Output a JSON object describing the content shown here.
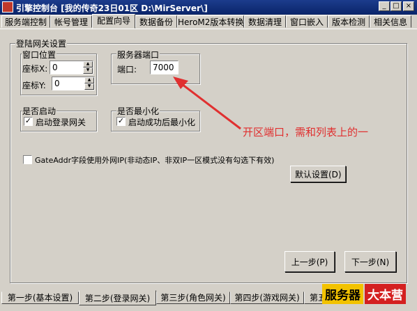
{
  "window": {
    "title": "引擎控制台 [我的传奇23日01区 D:\\MirServer\\]",
    "min_glyph": "_",
    "max_glyph": "□",
    "close_glyph": "×"
  },
  "tabs": [
    "服务端控制",
    "帐号管理",
    "配置向导",
    "数据备份",
    "HeroM2版本转换",
    "数据清理",
    "窗口嵌入",
    "版本检测",
    "相关信息"
  ],
  "active_tab": "配置向导",
  "gateway_group": {
    "title": "登陆网关设置",
    "window_pos": {
      "title": "窗口位置",
      "x_label": "座标X:",
      "x_value": "0",
      "y_label": "座标Y:",
      "y_value": "0"
    },
    "server_port": {
      "title": "服务器端口",
      "port_label": "端口:",
      "port_value": "7000"
    },
    "autostart": {
      "title": "是否启动",
      "checkbox_label": "启动登录网关",
      "checked": true
    },
    "minimize": {
      "title": "是否最小化",
      "checkbox_label": "启动成功后最小化",
      "checked": true
    },
    "gateaddr_label": "GateAddr字段使用外网IP(非动态IP、非双IP一区模式没有勾选下有效)",
    "gateaddr_checked": false,
    "default_button": "默认设置(D)"
  },
  "prev_button": "上一步(P)",
  "next_button": "下一步(N)",
  "bottom_tabs": [
    "第一步(基本设置)",
    "第二步(登录网关)",
    "第三步(角色网关)",
    "第四步(游戏网关)",
    "第五"
  ],
  "active_bottom_tab": "第二步(登录网关)",
  "annotation": "开区端口，需和列表上的一",
  "watermark": {
    "part1": "服务器",
    "part2": "大本营"
  },
  "colors": {
    "annotation": "#e03030",
    "titlebar": "#0a246a",
    "face": "#d4d0c8"
  }
}
